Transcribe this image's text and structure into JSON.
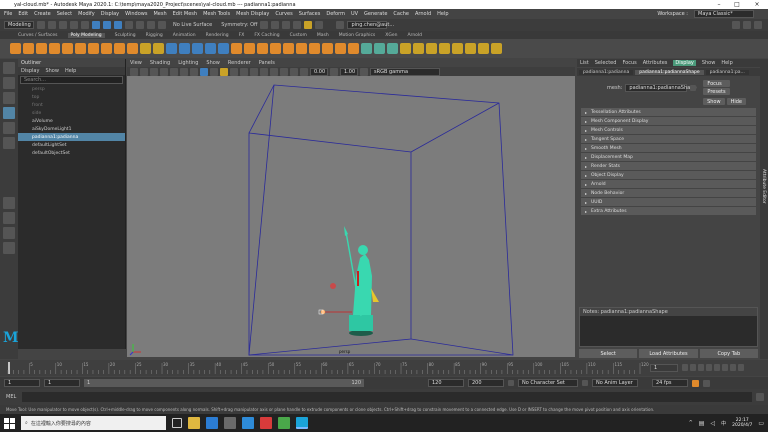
{
  "titlebar": {
    "title": "yal-cloud.mb* - Autodesk Maya 2020.1: C:\\temp\\maya2020_Project\\scenes\\yal-cloud.mb   ---   padianna1:padianna"
  },
  "menubar": {
    "items": [
      "File",
      "Edit",
      "Create",
      "Select",
      "Modify",
      "Display",
      "Windows",
      "Mesh",
      "Edit Mesh",
      "Mesh Tools",
      "Mesh Display",
      "Curves",
      "Surfaces",
      "Deform",
      "UV",
      "Generate",
      "Cache",
      "Arnold",
      "Help"
    ],
    "workspace_label": "Workspace :",
    "workspace_value": "Maya Classic*"
  },
  "statusline": {
    "mode": "Modeling",
    "surface": "No Live Surface",
    "symmetry": "Symmetry: Off",
    "user": "ping.chen@aut..."
  },
  "shelftabs": [
    "Curves / Surfaces",
    "Poly Modeling",
    "Sculpting",
    "Rigging",
    "Animation",
    "Rendering",
    "FX",
    "FX Caching",
    "Custom",
    "Mash",
    "Motion Graphics",
    "XGen",
    "Arnold"
  ],
  "outliner": {
    "title": "Outliner",
    "menu": [
      "Display",
      "Show",
      "Help"
    ],
    "search_placeholder": "Search...",
    "items": [
      {
        "label": "persp",
        "dim": true
      },
      {
        "label": "top",
        "dim": true
      },
      {
        "label": "front",
        "dim": true
      },
      {
        "label": "side",
        "dim": true
      },
      {
        "label": "aiVolume",
        "dim": false
      },
      {
        "label": "aiSkyDomeLight1",
        "dim": false
      },
      {
        "label": "padianna1:padianna",
        "dim": false
      },
      {
        "label": "defaultLightSet",
        "dim": false
      },
      {
        "label": "defaultObjectSet",
        "dim": false
      }
    ]
  },
  "viewport": {
    "menu": [
      "View",
      "Shading",
      "Lighting",
      "Show",
      "Renderer",
      "Panels"
    ],
    "exposure": "0.00",
    "gamma": "1.00",
    "colorspace": "sRGB gamma",
    "camera": "persp"
  },
  "attr": {
    "menu": [
      "List",
      "Selected",
      "Focus",
      "Attributes",
      "Display",
      "Show",
      "Help"
    ],
    "tabs": [
      "padianna1:padianna",
      "padianna1:padiannaShape",
      "padianna1:pa..."
    ],
    "mesh_label": "mesh:",
    "mesh_value": "padianna1:padiannaShape",
    "focus": "Focus",
    "presets": "Presets",
    "show": "Show",
    "hide": "Hide",
    "sections": [
      "Tessellation Attributes",
      "Mesh Component Display",
      "Mesh Controls",
      "Tangent Space",
      "Smooth Mesh",
      "Displacement Map",
      "Render Stats",
      "Object Display",
      "Arnold",
      "Node Behavior",
      "UUID",
      "Extra Attributes"
    ],
    "notes": "Notes:  padianna1:padiannaShape",
    "select": "Select",
    "load": "Load Attributes",
    "copy": "Copy Tab",
    "side_tab": "Attribute Editor"
  },
  "timeline": {
    "ticks": [
      "5",
      "10",
      "15",
      "20",
      "25",
      "30",
      "35",
      "40",
      "45",
      "50",
      "55",
      "60",
      "65",
      "70",
      "75",
      "80",
      "85",
      "90",
      "95",
      "100",
      "105",
      "110",
      "115",
      "120"
    ],
    "current": "1"
  },
  "range": {
    "start": "1",
    "start2": "1",
    "inner_start": "1",
    "inner_end": "120",
    "end1": "120",
    "end2": "200",
    "char_set": "No Character Set",
    "anim_layer": "No Anim Layer",
    "fps": "24 fps"
  },
  "cmd": {
    "label": "MEL"
  },
  "help": "Move Tool: Use manipulator to move object(s). Ctrl+middle-drag to move components along normals. Shift+drag manipulator axis or plane handle to extrude components or clone objects. Ctrl+Shift+drag to constrain movement to a connected edge. Use D or INSERT to change the move pivot position and axis orientation.",
  "taskbar": {
    "search": "在這裡輸入你要搜尋的內容",
    "time": "22:17",
    "date": "2020/4/7"
  }
}
